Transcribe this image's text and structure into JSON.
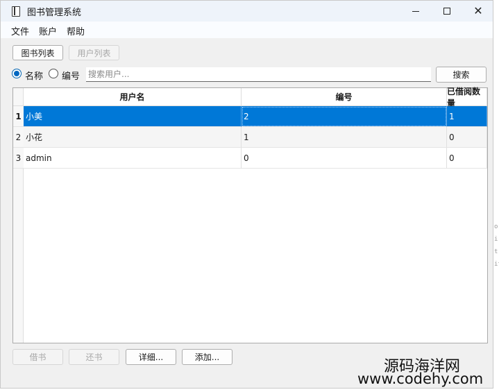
{
  "window": {
    "title": "图书管理系统",
    "controls": {
      "minimize": "—",
      "maximize": "☐",
      "close": "✕"
    }
  },
  "menu": [
    "文件",
    "账户",
    "帮助"
  ],
  "tabs": [
    {
      "label": "图书列表",
      "enabled": true
    },
    {
      "label": "用户列表",
      "enabled": false
    }
  ],
  "search": {
    "options": [
      {
        "label": "名称",
        "checked": true
      },
      {
        "label": "编号",
        "checked": false
      }
    ],
    "placeholder": "搜索用户...",
    "button": "搜索"
  },
  "table": {
    "headers": [
      "用户名",
      "编号",
      "已借阅数量"
    ],
    "rows": [
      {
        "num": "1",
        "cells": [
          "小美",
          "2",
          "1"
        ],
        "selected": true
      },
      {
        "num": "2",
        "cells": [
          "小花",
          "1",
          "0"
        ],
        "selected": false
      },
      {
        "num": "3",
        "cells": [
          "admin",
          "0",
          "0"
        ],
        "selected": false
      }
    ],
    "selection_color": "#0078d7"
  },
  "actions": {
    "borrow": "借书",
    "return": "还书",
    "details": "详细...",
    "add": "添加..."
  },
  "watermark": {
    "cn": "源码海洋网",
    "url": "www.codehy.com"
  }
}
